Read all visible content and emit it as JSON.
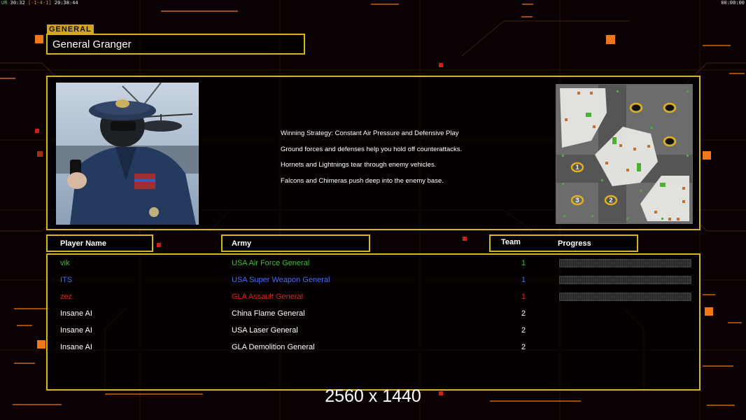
{
  "status_left": {
    "prefix": "UR",
    "counter": "30:32",
    "bracket": "[-1-4-1]",
    "clock": "20:38:44"
  },
  "status_right": "00:00:00",
  "general": {
    "label": "GENERAL",
    "name": "General Granger"
  },
  "strategy_lines": [
    "Winning Strategy: Constant Air Pressure and Defensive Play",
    "Ground forces and defenses help you hold off counterattacks.",
    "Hornets and Lightnings tear through enemy vehicles.",
    "Falcons and Chimeras push deep into the enemy base."
  ],
  "table_headers": {
    "player": "Player Name",
    "army": "Army",
    "team": "Team",
    "progress": "Progress"
  },
  "players": [
    {
      "name": "vik",
      "army": "USA Air Force General",
      "team": "1",
      "color": "#3fbf2f",
      "progress": 0
    },
    {
      "name": "ITS",
      "army": "USA Super Weapon General",
      "team": "1",
      "color": "#4a6cff",
      "progress": 0
    },
    {
      "name": "zez",
      "army": "GLA Assault General",
      "team": "1",
      "color": "#e8201c",
      "progress": 0
    },
    {
      "name": "Insane AI",
      "army": "China Flame General",
      "team": "2",
      "color": "#ffffff"
    },
    {
      "name": "Insane AI",
      "army": "USA Laser General",
      "team": "2",
      "color": "#ffffff"
    },
    {
      "name": "Insane AI",
      "army": "GLA Demolition General",
      "team": "2",
      "color": "#ffffff"
    }
  ],
  "map_start_positions": [
    "1",
    "2",
    "3"
  ],
  "resolution_text": "2560 x 1440",
  "colors": {
    "frame": "#d8b420",
    "accent": "#f07818",
    "label_bg": "#d2a41e"
  }
}
